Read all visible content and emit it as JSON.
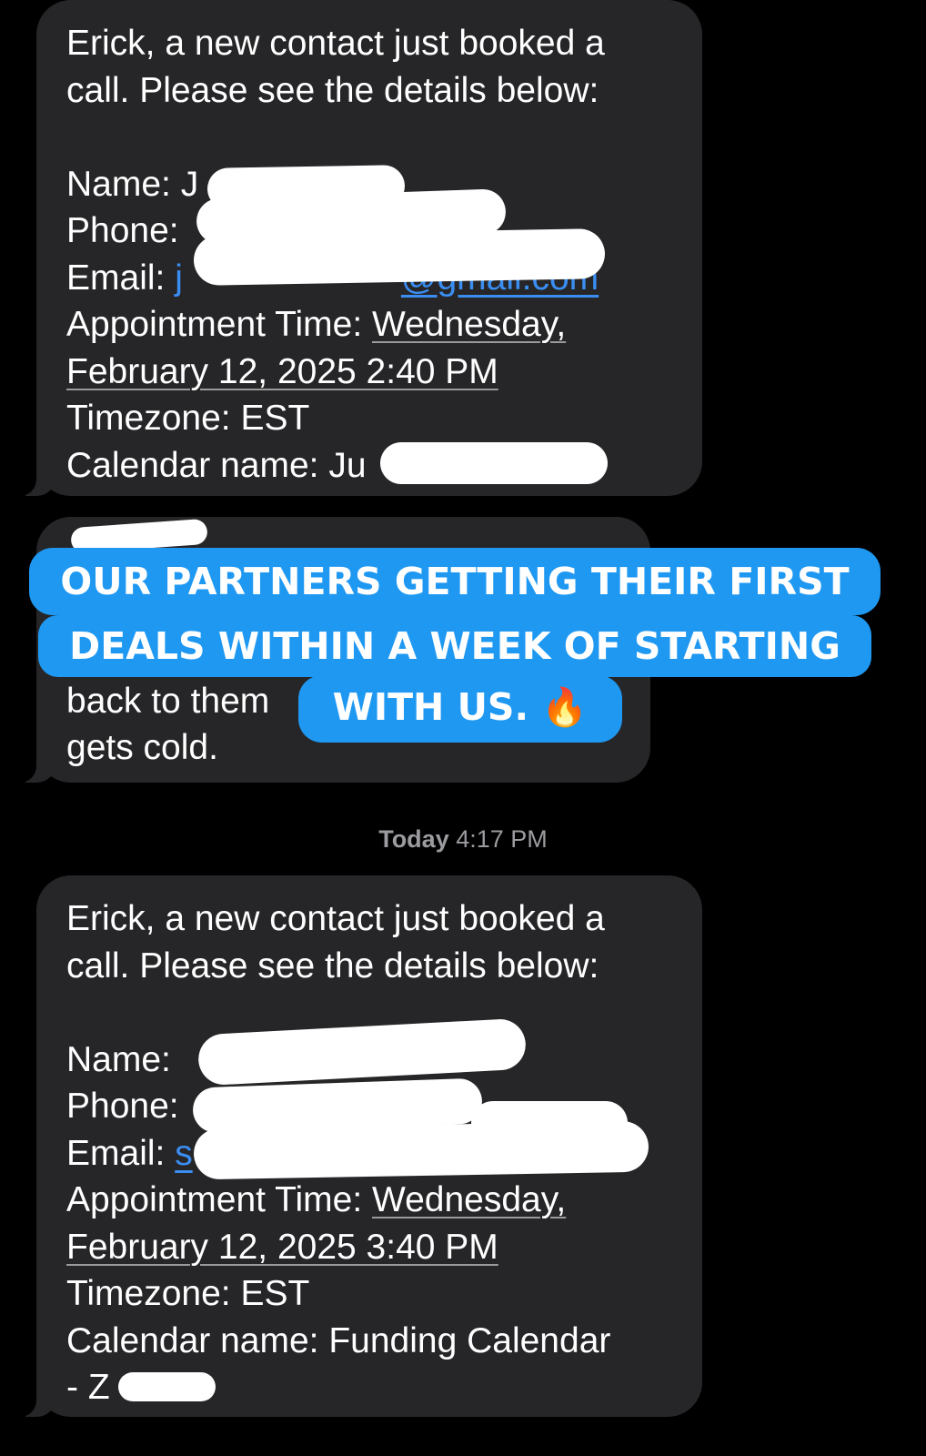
{
  "message1": {
    "intro_line1": "Erick, a new contact just booked a",
    "intro_line2": "call. Please see the details below:",
    "name_label": "Name: ",
    "name_frag": "J",
    "phone_label": "Phone: ",
    "email_label": "Email: ",
    "email_frag": "j",
    "email_tail": "@gmail.com",
    "appt_label": "Appointment Time: ",
    "appt_day": "Wednesday,",
    "appt_date": "February 12, 2025 2:40 PM",
    "timezone": "Timezone: EST",
    "calendar_label": "Calendar name: ",
    "calendar_frag": "Ju"
  },
  "message2": {
    "visible_line_1": "back to them",
    "visible_line_2": "gets cold."
  },
  "timestamp": {
    "day": "Today",
    "time": "4:17 PM"
  },
  "overlay": {
    "line1": "OUR PARTNERS GETTING THEIR FIRST",
    "line2": "DEALS WITHIN A WEEK OF STARTING",
    "line3": "WITH US.",
    "emoji": "🔥"
  },
  "message3": {
    "intro_line1": "Erick, a new contact just booked a",
    "intro_line2": "call. Please see the details below:",
    "name_label": "Name: ",
    "phone_label": "Phone:",
    "email_label": "Email: ",
    "email_frag": "s",
    "appt_label": "Appointment Time: ",
    "appt_day": "Wednesday,",
    "appt_date": "February 12, 2025 3:40 PM",
    "timezone": "Timezone: EST",
    "calendar_line1": "Calendar name: Funding Calendar",
    "calendar_line2": "- Z"
  }
}
